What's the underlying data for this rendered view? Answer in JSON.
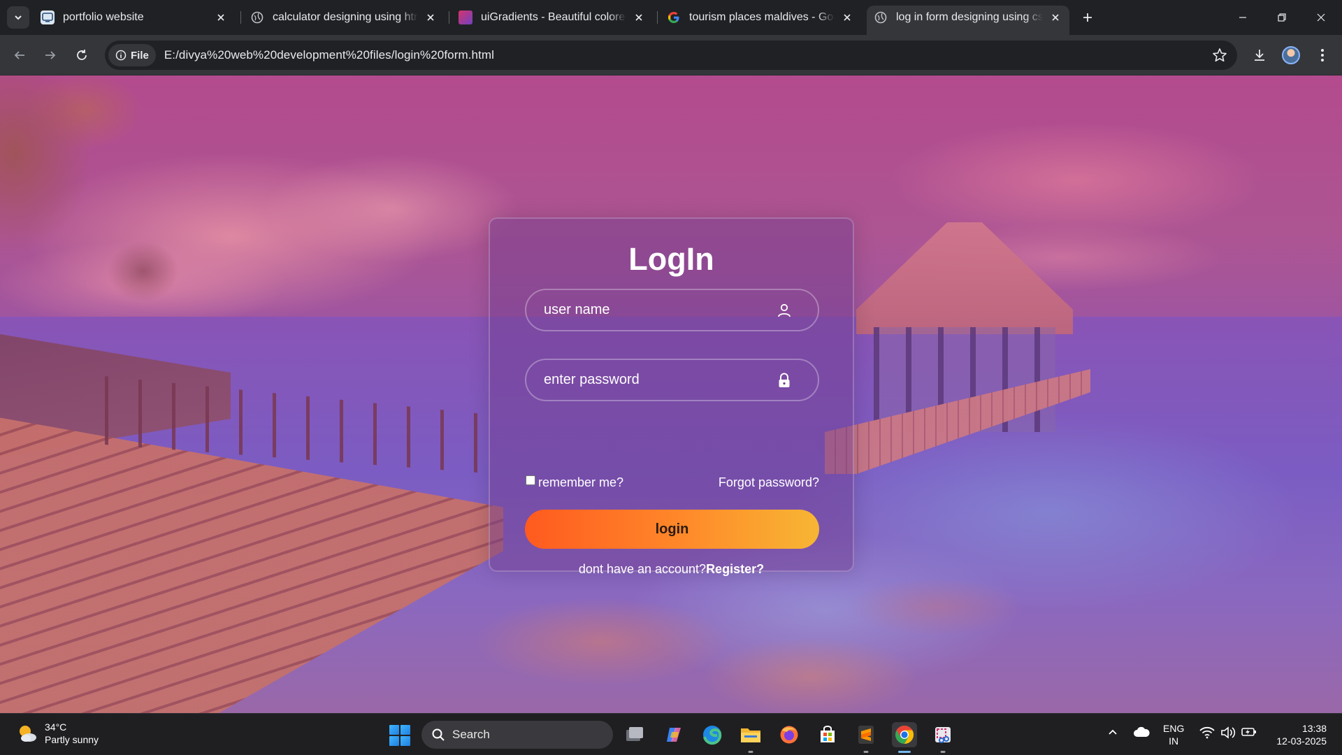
{
  "browser": {
    "tabs": [
      {
        "title": "portfolio website",
        "active": false,
        "favicon": "portfolio-favicon"
      },
      {
        "title": "calculator designing using html",
        "active": false,
        "favicon": "globe-icon"
      },
      {
        "title": "uiGradients - Beautiful colored gradients",
        "active": false,
        "favicon": "uigradients-favicon"
      },
      {
        "title": "tourism places maldives - Google Search",
        "active": false,
        "favicon": "google-icon"
      },
      {
        "title": "log in form designing using css.",
        "active": true,
        "favicon": "globe-icon"
      }
    ],
    "address": {
      "chip_label": "File",
      "url": "E:/divya%20web%20development%20files/login%20form.html"
    }
  },
  "page": {
    "title": "LogIn",
    "username_placeholder": "user name",
    "password_placeholder": "enter password",
    "remember_label": "remember me?",
    "remember_checked": false,
    "forgot_label": "Forgot password?",
    "login_button": "login",
    "register_prompt": "dont have an account?",
    "register_link": "Register?",
    "button_gradient": [
      "#ff5a1f",
      "#f7b634"
    ]
  },
  "taskbar": {
    "weather_temp": "34°C",
    "weather_desc": "Partly sunny",
    "search_label": "Search",
    "lang_line1": "ENG",
    "lang_line2": "IN",
    "time": "13:38",
    "date": "12-03-2025"
  }
}
